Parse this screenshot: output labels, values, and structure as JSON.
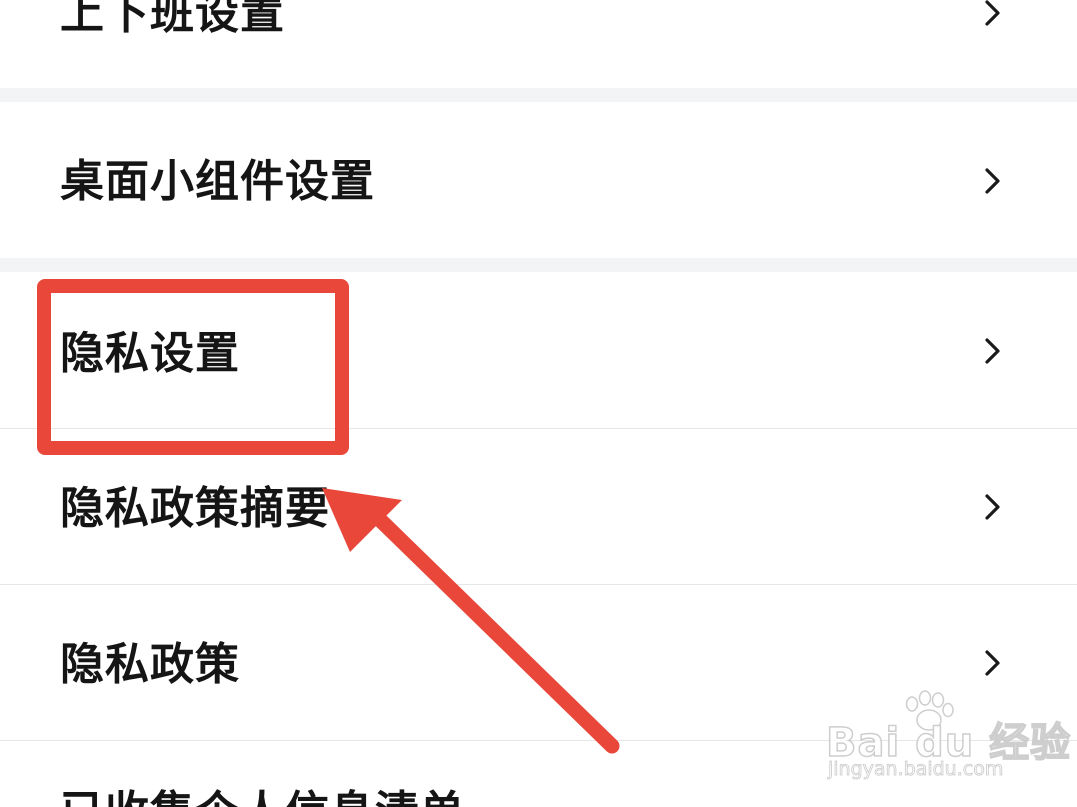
{
  "settings_list": {
    "items": [
      {
        "label": "上下班设置"
      },
      {
        "label": "桌面小组件设置"
      },
      {
        "label": "隐私设置"
      },
      {
        "label": "隐私政策摘要"
      },
      {
        "label": "隐私政策"
      },
      {
        "label": "已收集个人信息清单"
      }
    ],
    "chevron_icon": "chevron-right-icon"
  },
  "annotation": {
    "highlight_color": "#e8473a",
    "arrow_color": "#e8473a"
  },
  "watermark": {
    "brand": "Bai du 经验",
    "url": "jingyan.baidu.com"
  },
  "colors": {
    "background": "#ffffff",
    "section_gap": "#f3f4f6",
    "divider": "#e6e6e6",
    "text": "#151515",
    "chevron": "#1a1a1a"
  }
}
